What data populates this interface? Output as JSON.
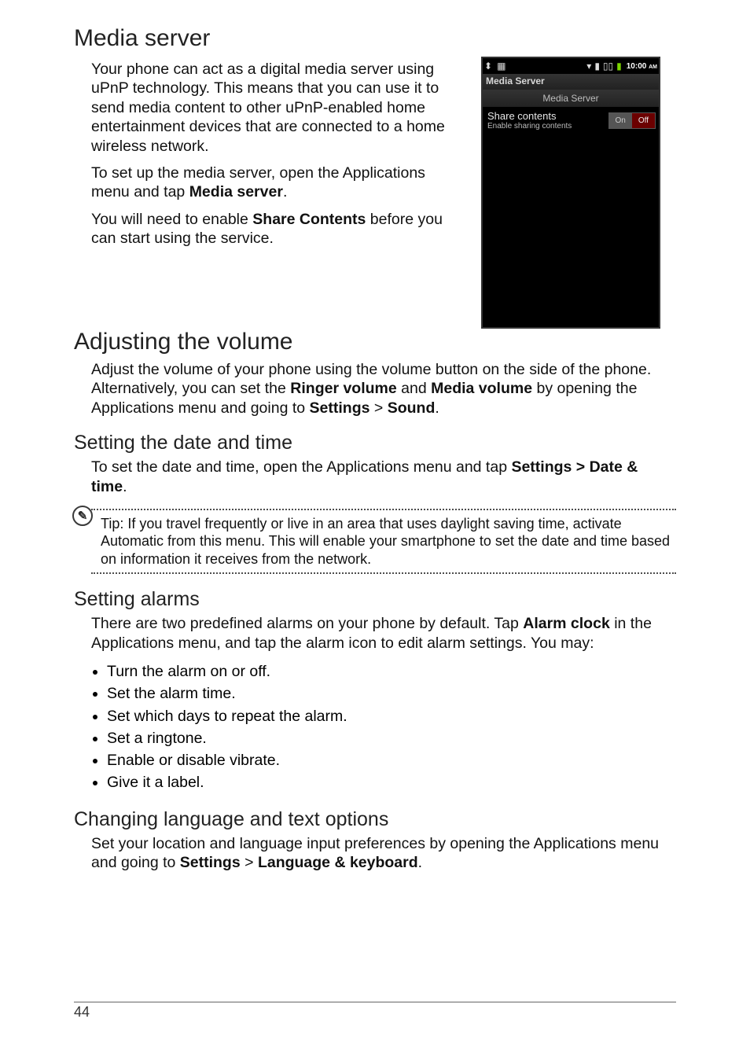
{
  "page_number": "44",
  "media_server": {
    "heading": "Media server",
    "p1": "Your phone can act as a digital media server using uPnP technology. This means that you can use it to send media content to other uPnP-enabled home entertainment devices that are connected to a home wireless network.",
    "p2_a": "To set up the media server, open the Applications menu and tap ",
    "p2_bold": "Media server",
    "p2_c": ".",
    "p3_a": "You will need to enable ",
    "p3_bold": "Share Contents",
    "p3_c": " before you can start using the service."
  },
  "phone_screenshot": {
    "time": "10:00",
    "ampm": "AM",
    "titlebar": "Media Server",
    "rowhead": "Media Server",
    "share_label": "Share contents",
    "share_sub": "Enable sharing contents",
    "toggle_on": "On",
    "toggle_off": "Off"
  },
  "adjust_volume": {
    "heading": "Adjusting the volume",
    "p_a": "Adjust the volume of your phone using the volume button on the side of the phone. Alternatively, you can set the ",
    "p_b1": "Ringer volume",
    "p_mid": " and ",
    "p_b2": "Media volume",
    "p_c": " by opening the Applications menu and going to ",
    "p_b3": "Settings",
    "p_d": " > ",
    "p_b4": "Sound",
    "p_e": "."
  },
  "date_time": {
    "heading": "Setting the date and time",
    "p_a": "To set the date and time, open the Applications menu and tap ",
    "p_b1": "Settings > Date & time",
    "p_c": "."
  },
  "tip": {
    "label": "Tip",
    "text_a": ": If you travel frequently or live in an area that uses daylight saving time, activate ",
    "bold": "Automatic",
    "text_b": " from this menu. This will enable your smartphone to set the date and time based on information it receives from the network."
  },
  "alarms": {
    "heading": "Setting alarms",
    "p_a": "There are two predefined alarms on your phone by default. Tap ",
    "p_b": "Alarm clock",
    "p_c": " in the Applications menu, and tap the alarm icon to edit alarm settings. You may:",
    "bullets": [
      "Turn the alarm on or off.",
      "Set the alarm time.",
      "Set which days to repeat the alarm.",
      "Set a ringtone.",
      "Enable or disable vibrate.",
      "Give it a label."
    ]
  },
  "language": {
    "heading": "Changing language and text options",
    "p_a": "Set your location and language input preferences by opening the Applications menu and going to ",
    "p_b": "Settings",
    "p_mid": " > ",
    "p_b2": "Language & keyboard",
    "p_c": "."
  }
}
